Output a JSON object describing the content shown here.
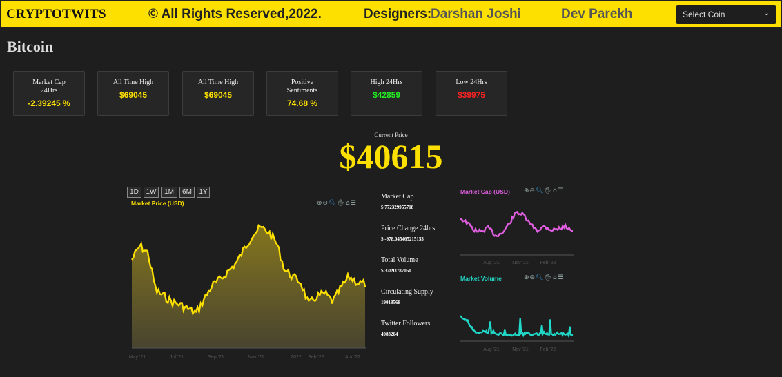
{
  "header": {
    "brand": "CRYPTOTWITS",
    "rights": "© All Rights Reserved,2022.",
    "designers_label": "Designers:",
    "designer_1": "Darshan Joshi",
    "designer_2": "Dev Parekh",
    "select_value": "Select Coin"
  },
  "coin": {
    "name": "Bitcoin"
  },
  "cards": [
    {
      "label": "Market Cap 24Hrs",
      "value": "-2.39245 %",
      "color": "#fde000"
    },
    {
      "label": "All Time High",
      "value": "$69045",
      "color": "#fde000"
    },
    {
      "label": "All Time High",
      "value": "$69045",
      "color": "#fde000"
    },
    {
      "label": "Positive Sentiments",
      "value": "74.68 %",
      "color": "#fde000"
    },
    {
      "label": "High 24Hrs",
      "value": "$42859",
      "color": "#22ee22"
    },
    {
      "label": "Low 24Hrs",
      "value": "$39975",
      "color": "#ff2222"
    }
  ],
  "current_price": {
    "label": "Current Price",
    "value": "$40615"
  },
  "ranges": [
    "1D",
    "1W",
    "1M",
    "6M",
    "1Y"
  ],
  "price_chart": {
    "title": "Market Price (USD)",
    "color": "#fde000",
    "xticks": [
      "May '21",
      "Jul '21",
      "Sep '21",
      "Nov '21",
      "2022",
      "Feb '22",
      "Apr '22"
    ]
  },
  "market_stats": [
    {
      "label": "Market Cap",
      "value": "$ 772329955718"
    },
    {
      "label": "Price Change 24hrs",
      "value": "$ -978.045465215153"
    },
    {
      "label": "Total Volume",
      "value": "$ 32893787050"
    },
    {
      "label": "Circulating Supply",
      "value": "19018568"
    },
    {
      "label": "Twitter Followers",
      "value": "4983204"
    }
  ],
  "cap_chart": {
    "title": "Market Cap (USD)",
    "color": "#e05ee0",
    "xticks": [
      "Aug '21",
      "Nov '21",
      "Feb '22"
    ]
  },
  "volume_chart": {
    "title": "Market Volume",
    "color": "#20d9c8",
    "xticks": [
      "Aug '21",
      "Nov '21",
      "Feb '22"
    ]
  },
  "toolbar_icons": [
    "zoom-in-icon",
    "zoom-out-icon",
    "magnifier-icon",
    "pan-hand-icon",
    "home-icon",
    "menu-icon"
  ]
}
